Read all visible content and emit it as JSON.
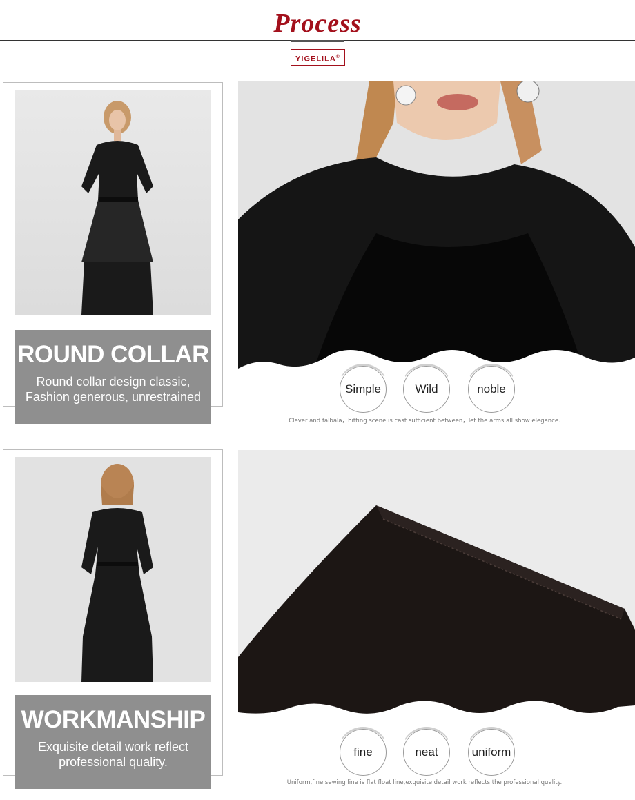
{
  "header": {
    "title": "Process",
    "brand": "YIGELILA",
    "brand_mark": "®"
  },
  "sections": [
    {
      "caption_title": "ROUND COLLAR",
      "caption_line1": "Round collar design classic,",
      "caption_line2": "Fashion generous, unrestrained",
      "features": [
        "Simple",
        "Wild",
        "noble"
      ],
      "note": "Clever and falbala，hitting scene is cast sufficient between，let the arms all show elegance."
    },
    {
      "caption_title": "WORKMANSHIP",
      "caption_line1": "Exquisite detail work reflect",
      "caption_line2": "professional quality.",
      "features": [
        "fine",
        "neat",
        "uniform"
      ],
      "note": "Uniform,fine sewing line is flat float line,exquisite detail work reflects the professional quality."
    }
  ],
  "colors": {
    "accent": "#a3101c",
    "caption_bg": "#8f8f8f"
  }
}
